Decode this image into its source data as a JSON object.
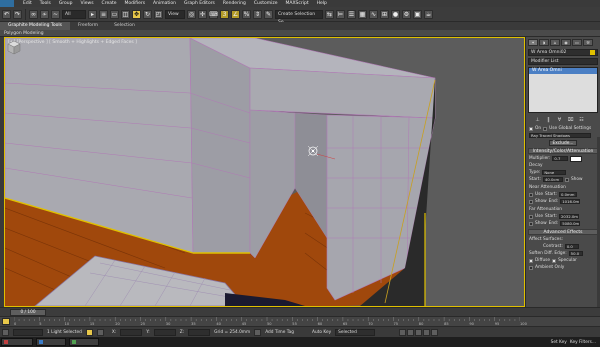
{
  "menu": [
    "Edit",
    "Tools",
    "Group",
    "Views",
    "Create",
    "Modifiers",
    "Animation",
    "Graph Editors",
    "Rendering",
    "Customize",
    "MAXScript",
    "Help"
  ],
  "toolbar": {
    "selection_filter": "All",
    "view_mode": "View",
    "named_selection": "Create Selection Se"
  },
  "ribbon": {
    "tabs": [
      "Graphite Modeling Tools",
      "Freeform",
      "Selection"
    ],
    "sub_label": "Polygon Modeling"
  },
  "viewport": {
    "label": "[+] [Perspective ] [ Smooth + Highlights + Edged Faces ]"
  },
  "command_panel": {
    "object_name": "W Area Omni02",
    "modifier_list": "Modifier List",
    "stack_item": "W Area Omni",
    "general": {
      "on_label": "On",
      "global_label": "Use Global Settings",
      "shadow_type": "Ray Traced Shadows",
      "exclude": "Exclude..."
    },
    "intensity": {
      "title": "Intensity/Color/Attenuation",
      "multiplier_label": "Multiplier:",
      "multiplier": "0.7",
      "decay_label": "Decay",
      "type_label": "Type:",
      "type": "None",
      "start_label": "Start:",
      "start": "40.0cm",
      "show_label": "Show"
    },
    "near_atten": {
      "title": "Near Attenuation",
      "use": "Use",
      "start_label": "Start:",
      "start": "0.0mm",
      "show": "Show",
      "end_label": "End:",
      "end": "1016.0m"
    },
    "far_atten": {
      "title": "Far Attenuation",
      "use": "Use",
      "start_label": "Start:",
      "start": "2032.0m",
      "show": "Show",
      "end_label": "End:",
      "end": "5080.0m"
    },
    "advanced": {
      "title": "Advanced Effects",
      "affect_surfaces": "Affect Surfaces:",
      "contrast_label": "Contrast:",
      "contrast": "0.0",
      "soften_label": "Soften Diff. Edge:",
      "soften": "50.0",
      "diffuse": "Diffuse",
      "specular": "Specular",
      "ambient": "Ambient Only"
    }
  },
  "timeline": {
    "frame": "0 / 100",
    "ticks": [
      "0",
      "5",
      "10",
      "15",
      "20",
      "25",
      "30",
      "35",
      "40",
      "45",
      "50",
      "55",
      "60",
      "65",
      "70",
      "75",
      "80",
      "85",
      "90",
      "95",
      "100"
    ]
  },
  "status": {
    "selected": "1 Light Selected",
    "grid": "Grid = 254.0mm",
    "add_time_tag": "Add Time Tag",
    "auto_key": "Auto Key",
    "set_key": "Set Key",
    "selected_dd": "Selected",
    "key_filters": "Key Filters..."
  },
  "taskbar": [
    {
      "label": "",
      "icon": "red"
    },
    {
      "label": "",
      "icon": "blue"
    },
    {
      "label": "",
      "icon": "green"
    }
  ],
  "colors": {
    "accent": "#e0c000",
    "floor": "#a0480c",
    "wall": "#a9a9b0",
    "wire": "#b07ab5",
    "light_color": "#ffffff"
  }
}
